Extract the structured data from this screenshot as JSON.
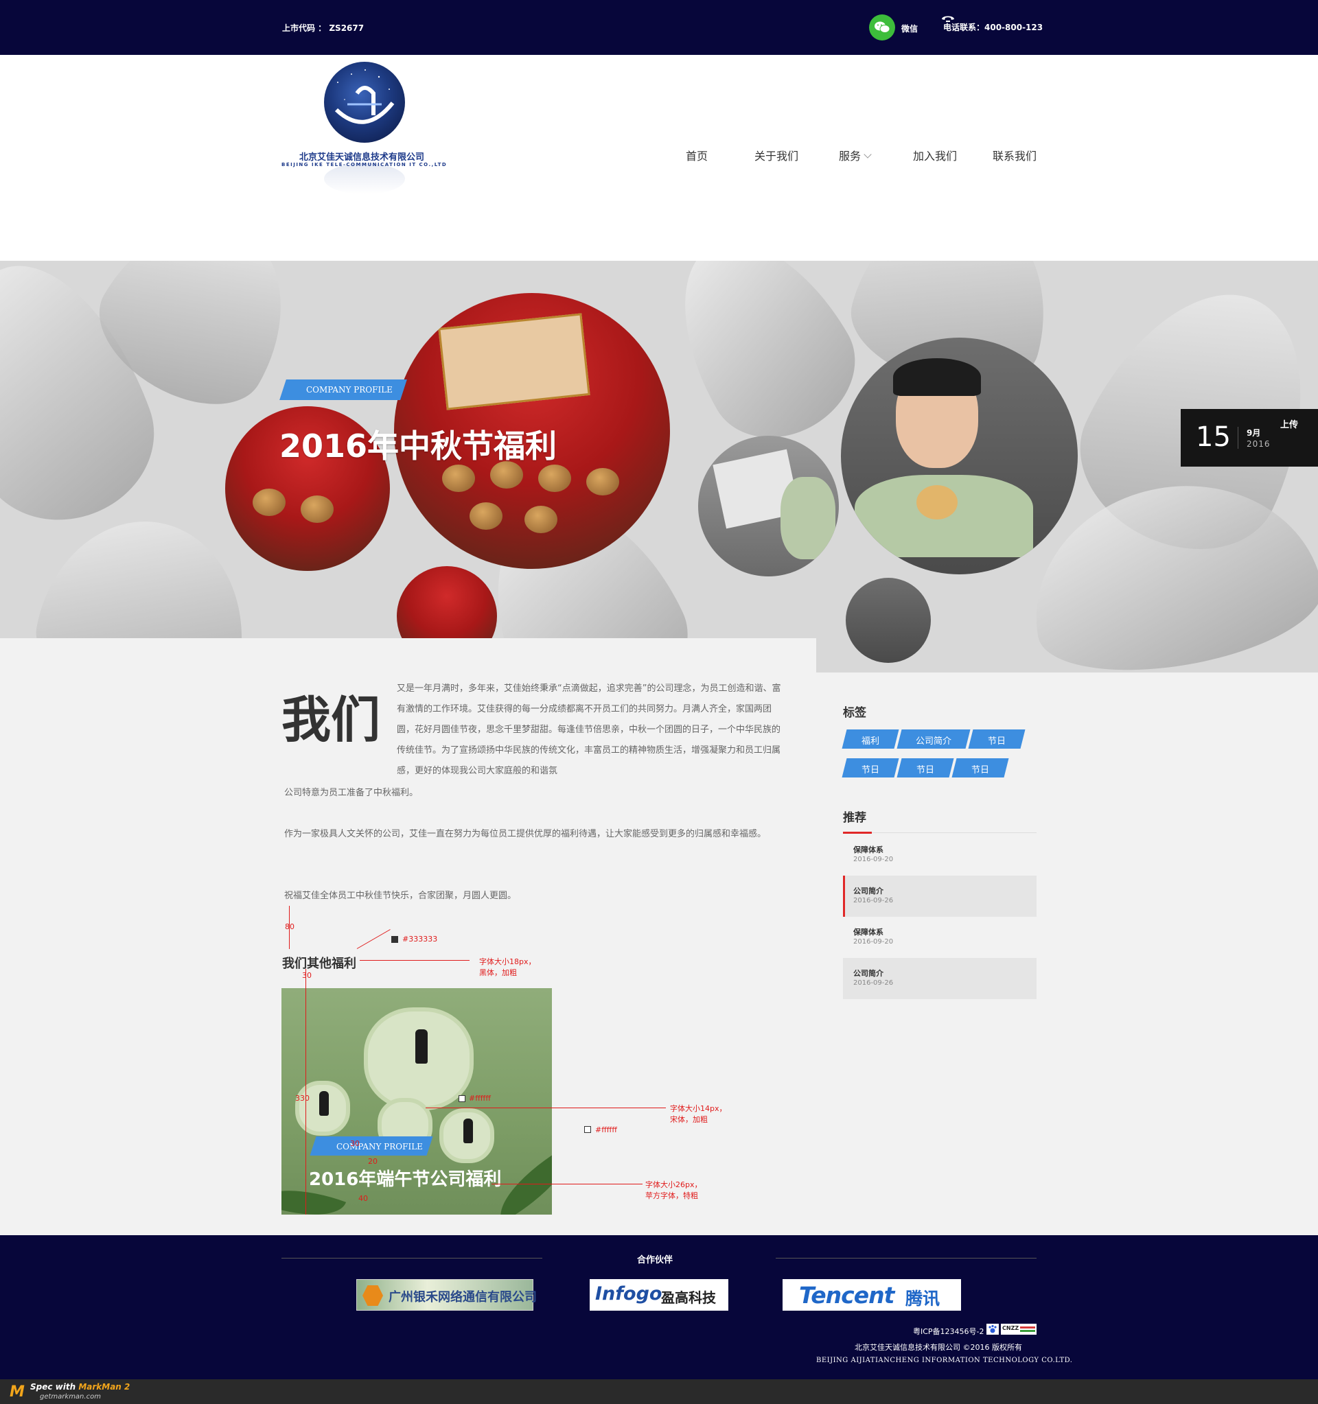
{
  "topbar": {
    "stock_code": "上市代码 ： ZS2677",
    "wechat_label": "微信",
    "phone_text": "电话联系：400-800-123"
  },
  "logo": {
    "name_cn": "北京艾佳天诚信息技术有限公司",
    "name_en": "BEIJING IKE TELE-COMMUNICATION IT CO.,LTD"
  },
  "nav": [
    {
      "label": "首页"
    },
    {
      "label": "关于我们"
    },
    {
      "label": "服务"
    },
    {
      "label": "加入我们"
    },
    {
      "label": "联系我们"
    }
  ],
  "banner": {
    "badge": "COMPANY PROFILE",
    "title": "2016年中秋节福利",
    "date": {
      "day": "15",
      "month": "9月",
      "year": "2016",
      "action": "上传"
    }
  },
  "article": {
    "heading": "我们",
    "p1a": "又是一年月满时，多年来，艾佳始终秉承“点滴做起，追求完善”的公司理念，为员工创造和谐、富有激情的工作环境。艾佳获得的每一分成绩都离不开员工们的共同努力。月满人齐全，家国两团圆，花好月圆佳节夜，思念千里梦甜甜。每逢佳节倍思亲，中秋一个团圆的日子，一个中华民族的传统佳节。为了宣扬颂扬中华民族的传统文化，丰富员工的精神物质生活，增强凝聚力和员工归属感，更好的体现我公司大家庭般的和谐氛",
    "p1b": "公司特意为员工准备了中秋福利。",
    "p2": "作为一家极具人文关怀的公司，艾佳一直在努力为每位员工提供优厚的福利待遇，让大家能感受到更多的归属感和幸福感。",
    "p3": "祝福艾佳全体员工中秋佳节快乐，合家团聚，月圆人更圆。",
    "other_title": "我们其他福利",
    "other_card": {
      "badge": "COMPANY PROFILE",
      "title": "2016年端午节公司福利"
    }
  },
  "annotations": {
    "gap_80": "80",
    "gap_30": "30",
    "color_333": "#333333",
    "font_18_line1": "字体大小18px，",
    "font_18_line2": "黑体，加粗",
    "h_330": "330",
    "color_fff_1": "#ffffff",
    "color_fff_2": "#ffffff",
    "font_14_line1": "字体大小14px，",
    "font_14_line2": "宋体，加粗",
    "n_30": "30",
    "n_20": "20",
    "n_40": "40",
    "font_26_line1": "字体大小26px，",
    "font_26_line2": "苹方字体，特粗"
  },
  "sidebar": {
    "tags_title": "标签",
    "tags": [
      "福利",
      "公司简介",
      "节日",
      "节日",
      "节日",
      "节日"
    ],
    "rec_title": "推荐",
    "recommend": [
      {
        "title": "保障体系",
        "date": "2016-09-20",
        "active": false
      },
      {
        "title": "公司简介",
        "date": "2016-09-26",
        "active": true
      },
      {
        "title": "保障体系",
        "date": "2016-09-20",
        "active": false
      },
      {
        "title": "公司简介",
        "date": "2016-09-26",
        "active": false
      }
    ]
  },
  "footer": {
    "partners_title": "合作伙伴",
    "partners": [
      {
        "name": "广州银禾网络通信有限公司"
      },
      {
        "name_a": "Infogo",
        "name_b": "盈高科技"
      },
      {
        "name_a": "Tencent",
        "name_b": "腾讯"
      }
    ],
    "icp": "粤ICP备123456号-2",
    "icp_badge": "CNZZ",
    "company": "北京艾佳天诚信息技术有限公司 ©2016 版权所有",
    "company_en": "BEIJING  AIJIATIANCHENG INFORMATION TECHNOLOGY CO.LTD."
  },
  "watermark": {
    "brand_prefix": "Spec with ",
    "brand_name": "MarkMan 2",
    "url": "getmarkman.com"
  },
  "colors": {
    "navy": "#07063a",
    "accent_blue": "#3d8ee0",
    "accent_red": "#e02828",
    "annotation_red": "#e01b1b"
  }
}
